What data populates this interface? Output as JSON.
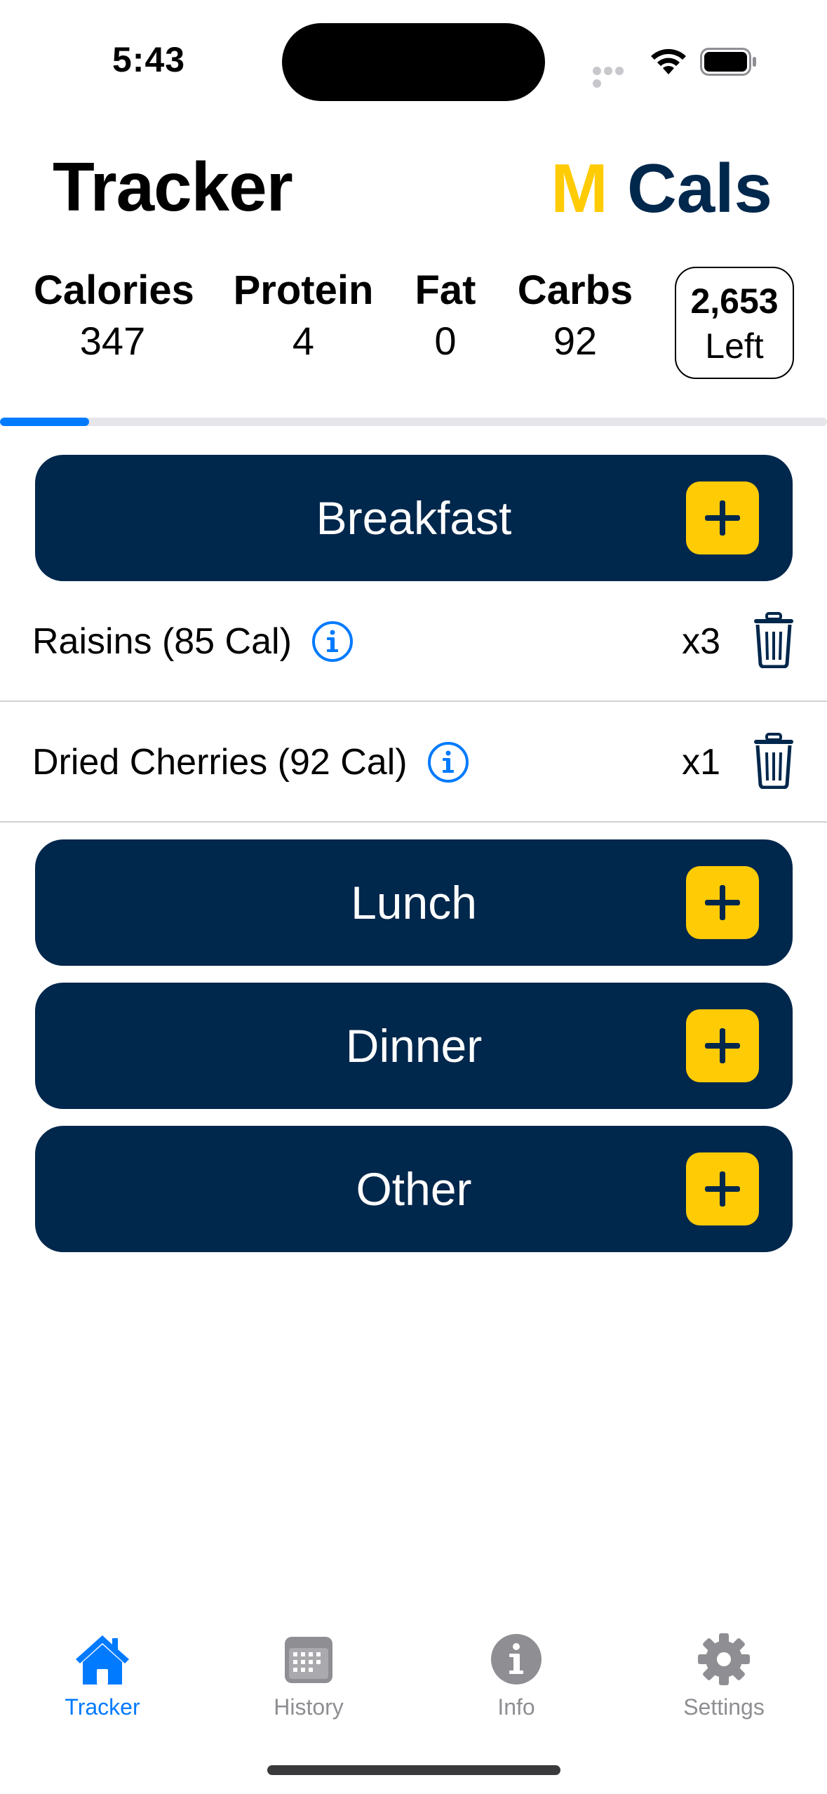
{
  "status_bar": {
    "time": "5:43"
  },
  "header": {
    "title": "Tracker",
    "brand_m": "M",
    "brand_cals": "Cals"
  },
  "macros": {
    "calories": {
      "label": "Calories",
      "value": "347"
    },
    "protein": {
      "label": "Protein",
      "value": "4"
    },
    "fat": {
      "label": "Fat",
      "value": "0"
    },
    "carbs": {
      "label": "Carbs",
      "value": "92"
    },
    "remaining": {
      "value": "2,653",
      "label": "Left"
    }
  },
  "progress": {
    "fraction": 0.108
  },
  "meals": {
    "breakfast": {
      "label": "Breakfast",
      "items": [
        {
          "name": "Raisins (85 Cal)",
          "qty": "x3"
        },
        {
          "name": "Dried Cherries (92 Cal)",
          "qty": "x1"
        }
      ]
    },
    "lunch": {
      "label": "Lunch"
    },
    "dinner": {
      "label": "Dinner"
    },
    "other": {
      "label": "Other"
    }
  },
  "tabs": [
    {
      "label": "Tracker",
      "icon": "house-icon",
      "active": true
    },
    {
      "label": "History",
      "icon": "calendar-icon",
      "active": false
    },
    {
      "label": "Info",
      "icon": "info-icon",
      "active": false
    },
    {
      "label": "Settings",
      "icon": "gear-icon",
      "active": false
    }
  ],
  "colors": {
    "navy": "#00274c",
    "maize": "#ffcb05",
    "accent_blue": "#007aff",
    "inactive_gray": "#8e8e93"
  }
}
